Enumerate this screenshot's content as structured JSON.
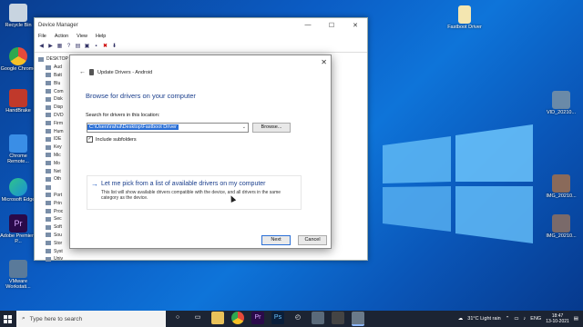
{
  "desktop": {
    "icons_left": [
      {
        "label": "Recycle Bin",
        "color": "#c8d4e0"
      },
      {
        "label": "Google Chrome",
        "color": "#e64a3b"
      },
      {
        "label": "HandBrake",
        "color": "#c0392b"
      },
      {
        "label": "Chrome Remote...",
        "color": "#3a8ee6"
      },
      {
        "label": "Microsoft Edge",
        "color": "#1a8fd6"
      },
      {
        "label": "Adobe Premiere P...",
        "color": "#2a0a4a"
      },
      {
        "label": "VMware Workstati...",
        "color": "#5a7a9a"
      }
    ],
    "icons_right": [
      {
        "label": "Fastboot Driver",
        "color": "#f4e6b0"
      },
      {
        "label": "VID_20210...",
        "color": "#6a8aa8"
      },
      {
        "label": "IMG_20210...",
        "color": "#8a6a5a"
      },
      {
        "label": "IMG_20210...",
        "color": "#7a6a6a"
      }
    ]
  },
  "device_manager": {
    "title": "Device Manager",
    "menu": [
      "File",
      "Action",
      "View",
      "Help"
    ],
    "tree": [
      "DESKTOP",
      "Aud",
      "Batt",
      "Blu",
      "Com",
      "Disk",
      "Disp",
      "DVD",
      "Firm",
      "Hum",
      "IDE",
      "Key",
      "Mic",
      "Mo",
      "Net",
      "Oth",
      "",
      "Port",
      "Prin",
      "Proc",
      "Sec",
      "Soft",
      "Sou",
      "Stor",
      "Syst",
      "Univ"
    ],
    "window_controls": [
      "—",
      "☐",
      "✕"
    ]
  },
  "dialog": {
    "header": "Update Drivers - Android",
    "close": "✕",
    "heading": "Browse for drivers on your computer",
    "search_label": "Search for drivers in this location:",
    "path_value": "C:\\Users\\rahul\\Desktop\\Fastboot Driver",
    "browse_label": "Browse...",
    "include_subfolders": "Include subfolders",
    "pick_title": "Let me pick from a list of available drivers on my computer",
    "pick_desc": "This list will show available drivers compatible with the device, and all drivers in the same category as the device.",
    "next_label": "Next",
    "cancel_label": "Cancel"
  },
  "taskbar": {
    "search_placeholder": "Type here to search",
    "weather": "31°C  Light rain",
    "language": "ENG",
    "time": "18:47",
    "date": "13-10-2021"
  }
}
